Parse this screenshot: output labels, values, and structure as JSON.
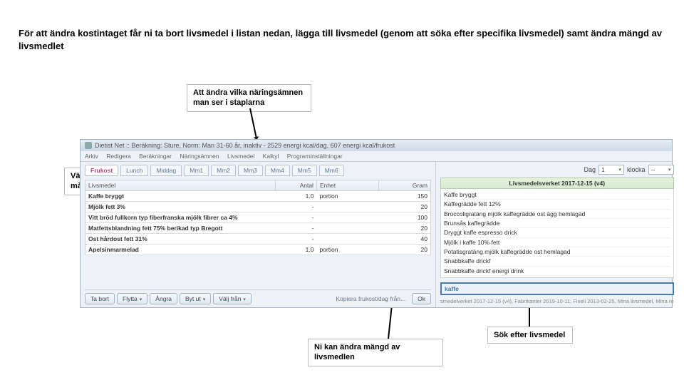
{
  "instruction": "För att ändra kostintaget får ni ta bort livsmedel i listan nedan, lägga till livsmedel (genom att söka efter specifika livsmedel) samt ändra mängd av livsmedlet",
  "callouts": {
    "c1": "Att ändra vilka näringsämnen man ser i staplarna",
    "c2": "Välja måltid",
    "c3": "Ni kan ändra mängd av livsmedlen",
    "c4": "Sök efter livsmedel"
  },
  "app": {
    "title": "Dietist Net :: Beräkning: Sture, Norm: Man 31-60 år, inaktiv - 2529 energi kcal/dag, 607 energi kcal/frukost",
    "menu": [
      "Arkiv",
      "Redigera",
      "Beräkningar",
      "Näringsämnen",
      "Livsmedel",
      "Kalkyl",
      "Programinställningar"
    ],
    "tabs": [
      "Frukost",
      "Lunch",
      "Middag",
      "Mm1",
      "Mm2",
      "Mm3",
      "Mm4",
      "Mm5",
      "Mm6"
    ],
    "active_tab": 0,
    "top_controls": {
      "day_label": "Dag",
      "day_value": "1",
      "klocka_label": "klocka",
      "klocka_value": "--"
    },
    "table": {
      "headers": [
        "Livsmedel",
        "Antal",
        "Enhet",
        "Gram"
      ],
      "rows": [
        {
          "name": "Kaffe bryggt",
          "antal": "1.0",
          "enhet": "portion",
          "gram": "150"
        },
        {
          "name": "Mjölk fett 3%",
          "antal": "-",
          "enhet": "",
          "gram": "20"
        },
        {
          "name": "Vitt bröd fullkorn typ fiberfranska mjölk fibrer ca 4%",
          "antal": "-",
          "enhet": "",
          "gram": "100"
        },
        {
          "name": "Matfettsblandning fett 75% berikad typ Bregott",
          "antal": "-",
          "enhet": "",
          "gram": "20"
        },
        {
          "name": "Ost hårdost fett 31%",
          "antal": "-",
          "enhet": "",
          "gram": "40"
        },
        {
          "name": "Apelsinmarmelad",
          "antal": "1.0",
          "enhet": "portion",
          "gram": "20"
        }
      ]
    },
    "buttons": {
      "ta_bort": "Ta bort",
      "flytta": "Flytta",
      "angra": "Ångra",
      "byt_ut": "Byt ut",
      "valj_fran": "Välj från",
      "kopiera": "Kopiera frukost/dag från...",
      "ok": "Ok"
    },
    "right": {
      "header": "Livsmedelsverket 2017-12-15 (v4)",
      "items": [
        "Kaffe bryggt",
        "Kaffegrädde fett 12%",
        "Broccoligratäng mjölk kaffegrädde ost ägg hemlagad",
        "Brunsås kaffegrädde",
        "Dryggt kaffe espresso drick",
        "Mjölk i kaffe 10% fett",
        "Potatisgratäng mjölk kaffegrädde ost hemlagad",
        "Snabbkaffe drickf",
        "Snabbkaffe drickf energi drink"
      ],
      "search_value": "kaffe",
      "db_line": "smedelverket 2017-12-15 (v4), Fabrikanter 2019-10-11, Fineli 2013-02-25, Mina livsmedel, Mina re"
    }
  }
}
